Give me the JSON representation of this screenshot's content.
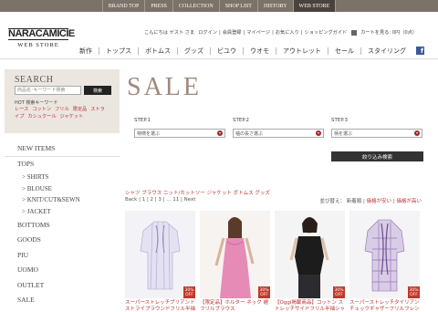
{
  "top_nav": [
    "BRAND TOP",
    "PRESS",
    "COLLECTION",
    "SHOP LIST",
    "HISTORY",
    "WEB STORE"
  ],
  "logo": {
    "name": "NARACAMICIE",
    "sub": "WEB STORE"
  },
  "util": {
    "greeting": "こんにちは ゲスト さま",
    "login": "ログイン",
    "register": "会員登録",
    "mypage": "マイページ",
    "favorites": "お気に入り",
    "guide": "ショッピングガイド",
    "cart": "カートを見る: 0円（0点）"
  },
  "global_nav": [
    "新作",
    "トップス",
    "ボトムス",
    "グッズ",
    "ビユウ",
    "ウオモ",
    "アウトレット",
    "セール",
    "スタイリング"
  ],
  "search": {
    "title": "SEARCH",
    "placeholder": "商品名･キーワード検索",
    "button": "検索",
    "hot_title": "HOT 検索キーワード",
    "hot_words": [
      "レース",
      "コットン",
      "フリル",
      "限定品",
      "ストライプ",
      "カシュクール",
      "ジャケット"
    ]
  },
  "categories": [
    {
      "label": "NEW ITEMS"
    },
    {
      "label": "TOPS"
    },
    {
      "label": "> SHIRTS",
      "sub": true
    },
    {
      "label": "> BLOUSE",
      "sub": true
    },
    {
      "label": "> KNIT/CUT&SEWN",
      "sub": true
    },
    {
      "label": "> JACKET",
      "sub": true
    },
    {
      "label": "BOTTOMS"
    },
    {
      "label": "GOODS"
    },
    {
      "label": "PIU"
    },
    {
      "label": "UOMO"
    },
    {
      "label": "OUTLET"
    },
    {
      "label": "SALE"
    }
  ],
  "main": {
    "title": "SALE",
    "steps": [
      {
        "label": "STEP.1",
        "select": "特徴を選ぶ"
      },
      {
        "label": "STEP.2",
        "select": "袖の長さ選ぶ"
      },
      {
        "label": "STEP.3",
        "select": "柄を選ぶ"
      }
    ],
    "narrow_button": "絞り込み検索",
    "crumbs": "シャツ ブラウス ニット/カットソー ジャケット ボトムス グッズ",
    "pager": "Back | 1 | 2 | 3 | ... 11 | Next",
    "sort": {
      "prefix": "並び替え：",
      "newest": "新着順",
      "cheap": "価格が安い",
      "expensive": "価格が高い"
    }
  },
  "products": [
    {
      "name": "スーパーストレッチブリアントストライプラウンドフリル半袖ブ",
      "badge": "30% OFF"
    },
    {
      "name": "【限定品】ホルター ネック 裾フリルブラウス",
      "badge": "30% OFF"
    },
    {
      "name": "【Oggi掲載商品】コットン ストレッチサイドフリル半袖シャツ",
      "badge": "30% OFF"
    },
    {
      "name": "スーパーストレッチタイリアンチェックギャザーフリルフレンチ",
      "badge": "30% OFF"
    }
  ],
  "colors": {
    "accent": "#a3262a",
    "brand_bar": "#7b7268",
    "title": "#a08a7c",
    "link": "#b33333"
  }
}
